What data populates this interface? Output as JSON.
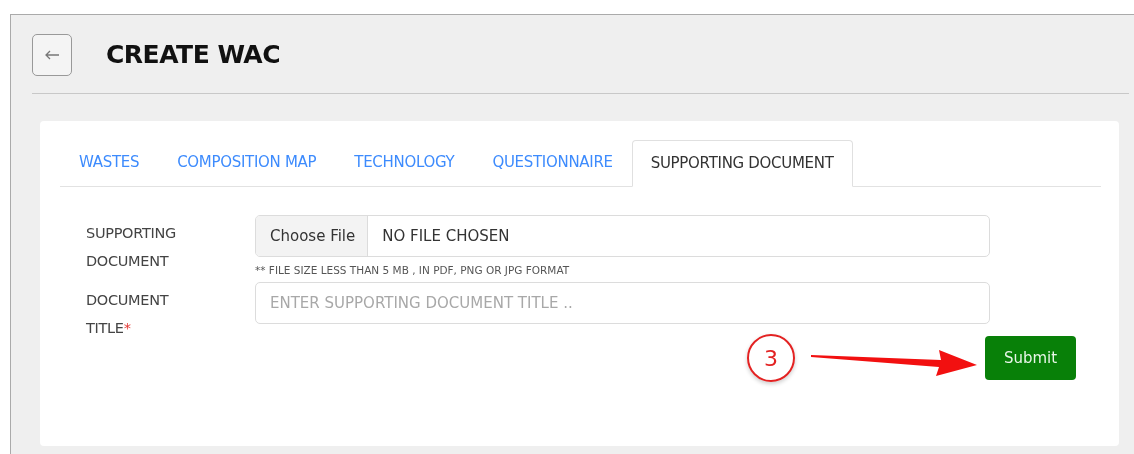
{
  "page": {
    "title": "CREATE WAC"
  },
  "tabs": [
    {
      "label": "WASTES",
      "selected": false
    },
    {
      "label": "COMPOSITION MAP",
      "selected": false
    },
    {
      "label": "TECHNOLOGY",
      "selected": false
    },
    {
      "label": "QUESTIONNAIRE",
      "selected": false
    },
    {
      "label": "SUPPORTING DOCUMENT",
      "selected": true
    }
  ],
  "form": {
    "fields": [
      {
        "kind": "file",
        "label": "SUPPORTING DOCUMENT",
        "button": "Choose File",
        "value": "NO FILE CHOSEN",
        "hint": "** FILE SIZE LESS THAN 5 MB , IN PDF, PNG OR JPG FORMAT"
      },
      {
        "kind": "text",
        "label": "DOCUMENT TITLE",
        "required_mark": "*",
        "placeholder": "ENTER SUPPORTING DOCUMENT TITLE .."
      }
    ],
    "submit": "Submit"
  },
  "annotation": {
    "number": "3"
  }
}
